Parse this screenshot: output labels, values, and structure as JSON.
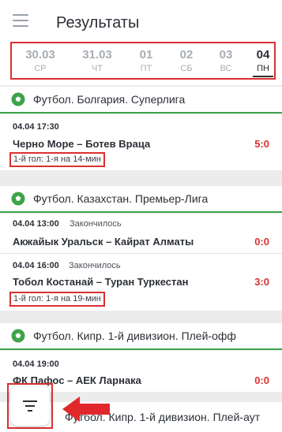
{
  "header": {
    "title": "Результаты"
  },
  "dates": [
    {
      "num": "30.03",
      "day": "СР"
    },
    {
      "num": "31.03",
      "day": "ЧТ"
    },
    {
      "num": "01",
      "day": "ПТ"
    },
    {
      "num": "02",
      "day": "СБ"
    },
    {
      "num": "03",
      "day": "ВС"
    },
    {
      "num": "04",
      "day": "ПН"
    }
  ],
  "leagues": [
    {
      "name": "Футбол. Болгария. Суперлига",
      "matches": [
        {
          "time": "04.04 17:30",
          "status": "",
          "teams": "Черно Море – Ботев Враца",
          "score": "5:0",
          "note": "1-й гол: 1-я на 14-мин"
        }
      ]
    },
    {
      "name": "Футбол. Казахстан. Премьер-Лига",
      "matches": [
        {
          "time": "04.04 13:00",
          "status": "Закончилось",
          "teams": "Акжайык Уральск – Кайрат Алматы",
          "score": "0:0",
          "note": ""
        },
        {
          "time": "04.04 16:00",
          "status": "Закончилось",
          "teams": "Тобол Костанай – Туран Туркестан",
          "score": "3:0",
          "note": "1-й гол: 1-я на 19-мин"
        }
      ]
    },
    {
      "name": "Футбол. Кипр. 1-й дивизион. Плей-офф",
      "matches": [
        {
          "time": "04.04 19:00",
          "status": "",
          "teams": "ФК Пафос – АЕК Ларнака",
          "score": "0:0",
          "note": ""
        }
      ]
    },
    {
      "name": "Футбол. Кипр. 1-й дивизион. Плей-аут",
      "matches": []
    }
  ],
  "icons": {
    "menu": "menu-icon",
    "league": "football-icon",
    "filter": "filter-icon",
    "arrow": "arrow-left-icon"
  },
  "colors": {
    "accent_green": "#3ea34a",
    "score_red": "#d9312f",
    "highlight_red": "#d9312f"
  }
}
